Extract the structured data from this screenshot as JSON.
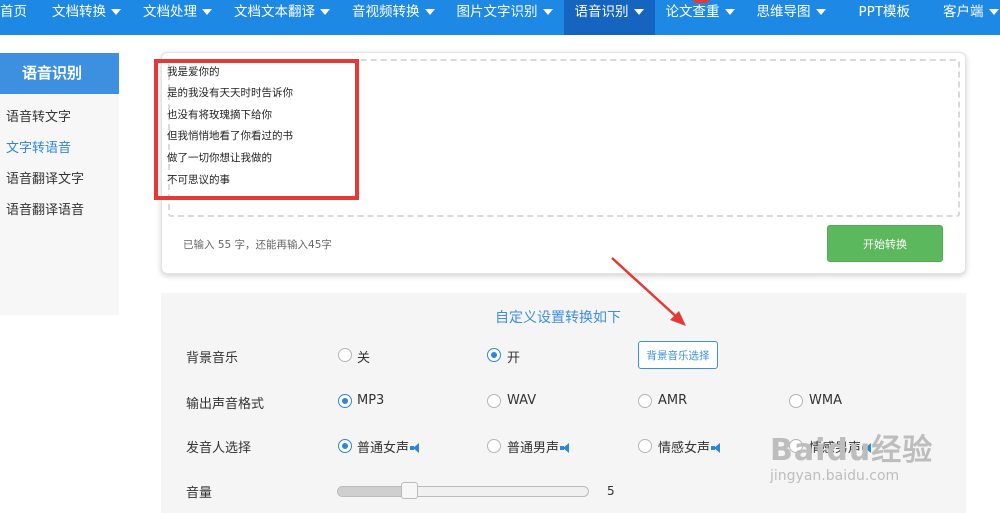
{
  "nav": {
    "items": [
      {
        "label": "首页",
        "caret": false
      },
      {
        "label": "文档转换",
        "caret": true
      },
      {
        "label": "文档处理",
        "caret": true
      },
      {
        "label": "文档文本翻译",
        "caret": true
      },
      {
        "label": "音视频转换",
        "caret": true
      },
      {
        "label": "图片文字识别",
        "caret": true
      },
      {
        "label": "语音识别",
        "caret": true,
        "active": true
      },
      {
        "label": "论文查重",
        "caret": true
      },
      {
        "label": "思维导图",
        "caret": true
      },
      {
        "label": "PPT模板",
        "caret": false
      },
      {
        "label": "客户端",
        "caret": true
      }
    ]
  },
  "sidebar": {
    "title": "语音识别",
    "items": [
      {
        "label": "语音转文字"
      },
      {
        "label": "文字转语音",
        "current": true
      },
      {
        "label": "语音翻译文字"
      },
      {
        "label": "语音翻译语音"
      }
    ]
  },
  "input": {
    "lines": [
      "我是爱你的",
      "是的我没有天天时时告诉你",
      "也没有将玫瑰摘下给你",
      "但我悄悄地看了你看过的书",
      "做了一切你想让我做的",
      "不可思议的事"
    ],
    "count_text": "已输入 55 字，还能再输入45字",
    "start_button": "开始转换"
  },
  "settings": {
    "title": "自定义设置转换如下",
    "bg_music": {
      "label": "背景音乐",
      "off": "关",
      "on": "开",
      "selected": "开",
      "choose_button": "背景音乐选择"
    },
    "format": {
      "label": "输出声音格式",
      "options": [
        "MP3",
        "WAV",
        "AMR",
        "WMA"
      ],
      "selected": "MP3"
    },
    "voice": {
      "label": "发音人选择",
      "options": [
        "普通女声",
        "普通男声",
        "情感女声",
        "情感男声"
      ],
      "selected": "普通女声"
    },
    "volume": {
      "label": "音量",
      "value": "5",
      "fraction": 0.27
    }
  },
  "watermark": {
    "brand": "Baidu经验",
    "url": "jingyan.baidu.com"
  },
  "colors": {
    "nav_bg": "#1e88e5",
    "accent": "#3d8fe0",
    "start_green": "#5cb85c",
    "annotation_red": "#e53935"
  }
}
